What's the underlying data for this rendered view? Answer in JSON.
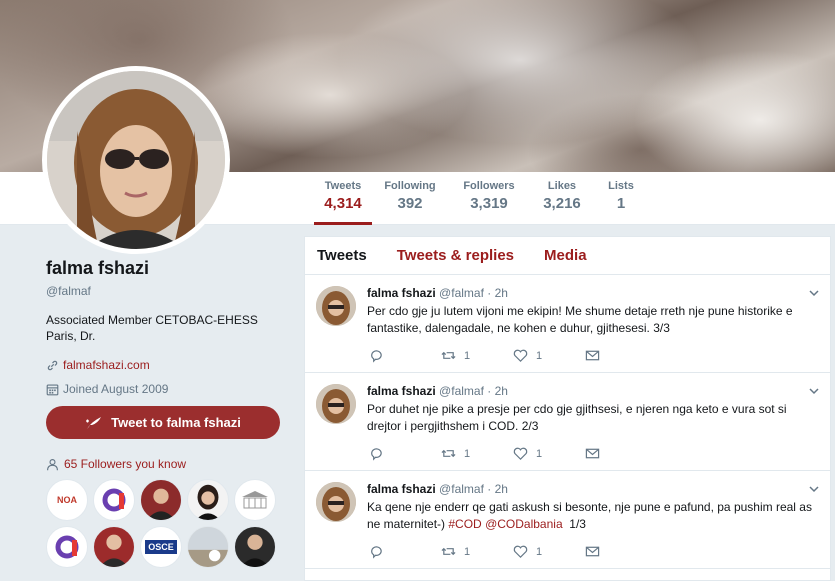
{
  "profile": {
    "name": "falma fshazi",
    "handle": "@falmaf",
    "bio_line1": "Associated Member CETOBAC-EHESS",
    "bio_line2": "Paris, Dr.",
    "website": "falmafshazi.com",
    "joined": "Joined August 2009",
    "tweet_to_label": "Tweet to falma fshazi",
    "followers_you_know": "65 Followers you know"
  },
  "nav": {
    "tweets_label": "Tweets",
    "tweets_value": "4,314",
    "following_label": "Following",
    "following_value": "392",
    "followers_label": "Followers",
    "followers_value": "3,319",
    "likes_label": "Likes",
    "likes_value": "3,216",
    "lists_label": "Lists",
    "lists_value": "1"
  },
  "timeline": {
    "tabs": [
      "Tweets",
      "Tweets & replies",
      "Media"
    ],
    "tweets": [
      {
        "name": "falma fshazi",
        "handle": "@falmaf",
        "time": "· 2h",
        "text": "Per cdo gje ju lutem vijoni me ekipin! Me shume detaje rreth nje pune historike e fantastike, dalengadale, ne kohen e duhur, gjithesesi. 3/3",
        "retweets": "1",
        "likes": "1"
      },
      {
        "name": "falma fshazi",
        "handle": "@falmaf",
        "time": "· 2h",
        "text": "Por duhet nje pike a presje per cdo gje gjithsesi, e njeren nga keto e vura sot si drejtor i pergjithshem i COD. 2/3",
        "retweets": "1",
        "likes": "1"
      },
      {
        "name": "falma fshazi",
        "handle": "@falmaf",
        "time": "· 2h",
        "text_pre": "Ka qene nje enderr qe gati askush si besonte, nje pune e pafund, pa pushim real as ne maternitet-) ",
        "hashtag": "#COD",
        "mention": "@CODalbania",
        "text_post": "1/3",
        "retweets": "1",
        "likes": "1"
      }
    ]
  },
  "avatars": {
    "noa": "NOA",
    "osce": "OSCE"
  },
  "colors": {
    "accent": "#9b1d1d",
    "button": "#9b2e2e"
  }
}
